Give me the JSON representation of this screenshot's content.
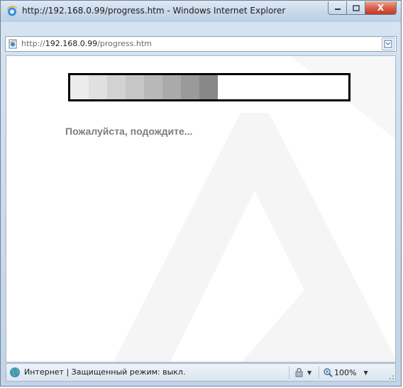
{
  "window": {
    "title": "http://192.168.0.99/progress.htm - Windows Internet Explorer",
    "close_glyph": "X"
  },
  "address": {
    "prefix": "http://",
    "host": "192.168.0.99",
    "path": "/progress.htm"
  },
  "page": {
    "wait_message": "Пожалуйста, подождите...",
    "progress_segments_filled": 8,
    "progress_fraction": 0.53,
    "progress_colors": [
      "#ececec",
      "#e0e0e0",
      "#d2d2d2",
      "#c6c6c6",
      "#b8b8b8",
      "#aaaaaa",
      "#9a9a9a",
      "#888888"
    ]
  },
  "status": {
    "text": "Интернет | Защищенный режим: выкл.",
    "zoom": "100%"
  },
  "icons": [
    "ie-logo-icon",
    "page-icon",
    "compatibility-view-icon",
    "globe-icon",
    "security-lock-icon",
    "zoom-icon",
    "chevron-down-icon"
  ]
}
